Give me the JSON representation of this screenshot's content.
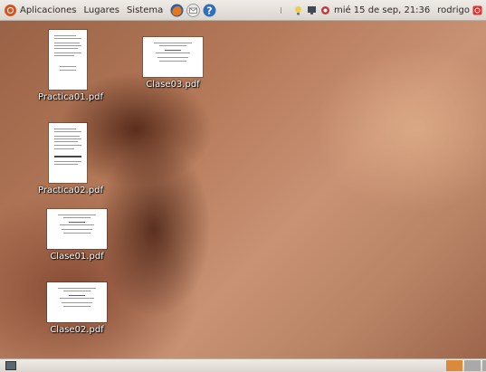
{
  "top_panel": {
    "menus": [
      "Aplicaciones",
      "Lugares",
      "Sistema"
    ],
    "clock": "mié 15 de sep, 21:36",
    "user": "rodrigo"
  },
  "desktop_icons": [
    {
      "label": "Practica01.pdf"
    },
    {
      "label": "Clase03.pdf"
    },
    {
      "label": "Practica02.pdf"
    },
    {
      "label": "Clase01.pdf"
    },
    {
      "label": "Clase02.pdf"
    }
  ],
  "colors": {
    "panel": "#dcd6cf",
    "workspace_active": "#d98a3a",
    "workspace_inactive": "#a9a9a9"
  }
}
